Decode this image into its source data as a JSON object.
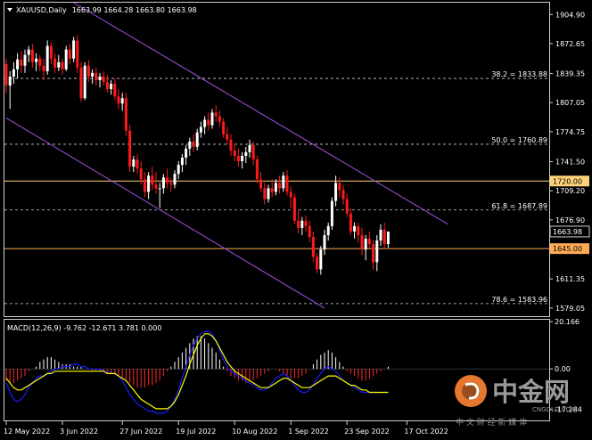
{
  "chart_data": [
    {
      "type": "candlestick",
      "title": "XAUUSD,Daily",
      "ohlc_readout": "1663.99 1664.28 1663.80 1663.98",
      "ylim": [
        1570,
        1918
      ],
      "y_ticks": [
        "1904.90",
        "1872.65",
        "1839.35",
        "1807.05",
        "1774.75",
        "1741.50",
        "1709.20",
        "1676.90",
        "1644.60",
        "1611.35",
        "1579.05"
      ],
      "x_ticks": [
        "12 May 2022",
        "3 Jun 2022",
        "27 Jun 2022",
        "19 Jul 2022",
        "10 Aug 2022",
        "1 Sep 2022",
        "23 Sep 2022",
        "17 Oct 2022"
      ],
      "x_tick_index": [
        0,
        15,
        31,
        46,
        61,
        76,
        91,
        107
      ],
      "last_price_label": "1663.98",
      "last_price": 1663.98,
      "horizontal_levels": [
        {
          "label": "1720.00",
          "value": 1720.0,
          "color": "#ffd27a"
        },
        {
          "label": "1645.00",
          "value": 1645.0,
          "color": "#ffaa55"
        }
      ],
      "fib_levels": [
        {
          "label": "38.2 = 1833.88",
          "value": 1833.88
        },
        {
          "label": "50.0 = 1760.89",
          "value": 1760.89
        },
        {
          "label": "61.8 = 1687.89",
          "value": 1687.89
        },
        {
          "label": "78.6 = 1583.96",
          "value": 1583.96
        }
      ],
      "channel": {
        "color": "#a24fe0",
        "upper": [
          {
            "i": 18,
            "v": 1918
          },
          {
            "i": 118,
            "v": 1672
          }
        ],
        "lower": [
          {
            "i": 0,
            "v": 1790
          },
          {
            "i": 85,
            "v": 1579
          }
        ]
      },
      "candles": [
        [
          1850,
          1856,
          1818,
          1826
        ],
        [
          1826,
          1842,
          1800,
          1836
        ],
        [
          1836,
          1852,
          1828,
          1844
        ],
        [
          1844,
          1862,
          1834,
          1855
        ],
        [
          1855,
          1864,
          1840,
          1848
        ],
        [
          1848,
          1866,
          1840,
          1860
        ],
        [
          1860,
          1870,
          1852,
          1866
        ],
        [
          1866,
          1872,
          1846,
          1852
        ],
        [
          1852,
          1862,
          1842,
          1856
        ],
        [
          1856,
          1860,
          1842,
          1848
        ],
        [
          1848,
          1856,
          1832,
          1842
        ],
        [
          1842,
          1876,
          1838,
          1870
        ],
        [
          1870,
          1874,
          1850,
          1856
        ],
        [
          1856,
          1862,
          1840,
          1846
        ],
        [
          1846,
          1860,
          1842,
          1852
        ],
        [
          1852,
          1856,
          1838,
          1844
        ],
        [
          1844,
          1870,
          1842,
          1866
        ],
        [
          1866,
          1872,
          1850,
          1856
        ],
        [
          1856,
          1880,
          1852,
          1876
        ],
        [
          1876,
          1882,
          1840,
          1846
        ],
        [
          1846,
          1852,
          1808,
          1812
        ],
        [
          1812,
          1852,
          1810,
          1848
        ],
        [
          1848,
          1854,
          1830,
          1836
        ],
        [
          1836,
          1844,
          1828,
          1840
        ],
        [
          1840,
          1846,
          1826,
          1832
        ],
        [
          1832,
          1840,
          1824,
          1836
        ],
        [
          1836,
          1842,
          1826,
          1830
        ],
        [
          1830,
          1838,
          1818,
          1822
        ],
        [
          1822,
          1832,
          1816,
          1828
        ],
        [
          1828,
          1834,
          1810,
          1814
        ],
        [
          1814,
          1822,
          1800,
          1806
        ],
        [
          1806,
          1818,
          1798,
          1812
        ],
        [
          1812,
          1818,
          1770,
          1776
        ],
        [
          1776,
          1782,
          1730,
          1736
        ],
        [
          1736,
          1748,
          1730,
          1744
        ],
        [
          1744,
          1750,
          1728,
          1734
        ],
        [
          1734,
          1742,
          1716,
          1722
        ],
        [
          1722,
          1730,
          1702,
          1708
        ],
        [
          1708,
          1730,
          1700,
          1726
        ],
        [
          1726,
          1736,
          1710,
          1716
        ],
        [
          1716,
          1730,
          1706,
          1712
        ],
        [
          1712,
          1718,
          1690,
          1712
        ],
        [
          1712,
          1728,
          1706,
          1724
        ],
        [
          1724,
          1734,
          1712,
          1718
        ],
        [
          1718,
          1724,
          1708,
          1716
        ],
        [
          1716,
          1732,
          1712,
          1728
        ],
        [
          1728,
          1742,
          1722,
          1738
        ],
        [
          1738,
          1750,
          1730,
          1746
        ],
        [
          1746,
          1760,
          1738,
          1756
        ],
        [
          1756,
          1768,
          1748,
          1764
        ],
        [
          1764,
          1772,
          1752,
          1758
        ],
        [
          1758,
          1778,
          1754,
          1774
        ],
        [
          1774,
          1786,
          1768,
          1780
        ],
        [
          1780,
          1792,
          1772,
          1788
        ],
        [
          1788,
          1796,
          1776,
          1782
        ],
        [
          1782,
          1800,
          1778,
          1796
        ],
        [
          1796,
          1804,
          1786,
          1792
        ],
        [
          1792,
          1798,
          1780,
          1786
        ],
        [
          1786,
          1790,
          1768,
          1772
        ],
        [
          1772,
          1780,
          1760,
          1766
        ],
        [
          1766,
          1772,
          1748,
          1754
        ],
        [
          1754,
          1762,
          1742,
          1748
        ],
        [
          1748,
          1756,
          1736,
          1742
        ],
        [
          1742,
          1752,
          1734,
          1748
        ],
        [
          1748,
          1758,
          1740,
          1752
        ],
        [
          1752,
          1766,
          1746,
          1760
        ],
        [
          1760,
          1764,
          1738,
          1744
        ],
        [
          1744,
          1748,
          1718,
          1722
        ],
        [
          1722,
          1730,
          1708,
          1712
        ],
        [
          1712,
          1718,
          1694,
          1700
        ],
        [
          1700,
          1716,
          1696,
          1712
        ],
        [
          1712,
          1722,
          1702,
          1708
        ],
        [
          1708,
          1722,
          1704,
          1718
        ],
        [
          1718,
          1726,
          1706,
          1712
        ],
        [
          1712,
          1730,
          1708,
          1726
        ],
        [
          1726,
          1732,
          1704,
          1708
        ],
        [
          1708,
          1714,
          1690,
          1702
        ],
        [
          1702,
          1706,
          1672,
          1676
        ],
        [
          1676,
          1688,
          1662,
          1668
        ],
        [
          1668,
          1680,
          1660,
          1676
        ],
        [
          1676,
          1682,
          1664,
          1670
        ],
        [
          1670,
          1676,
          1652,
          1658
        ],
        [
          1658,
          1664,
          1630,
          1636
        ],
        [
          1636,
          1640,
          1618,
          1622
        ],
        [
          1622,
          1648,
          1616,
          1644
        ],
        [
          1644,
          1666,
          1638,
          1660
        ],
        [
          1660,
          1674,
          1654,
          1670
        ],
        [
          1670,
          1702,
          1666,
          1698
        ],
        [
          1698,
          1726,
          1692,
          1718
        ],
        [
          1718,
          1724,
          1702,
          1710
        ],
        [
          1710,
          1716,
          1694,
          1700
        ],
        [
          1700,
          1706,
          1680,
          1684
        ],
        [
          1684,
          1690,
          1660,
          1664
        ],
        [
          1664,
          1674,
          1656,
          1670
        ],
        [
          1670,
          1674,
          1652,
          1660
        ],
        [
          1660,
          1668,
          1638,
          1644
        ],
        [
          1644,
          1660,
          1632,
          1656
        ],
        [
          1656,
          1664,
          1646,
          1650
        ],
        [
          1650,
          1654,
          1622,
          1630
        ],
        [
          1630,
          1660,
          1620,
          1654
        ],
        [
          1654,
          1672,
          1648,
          1666
        ],
        [
          1666,
          1674,
          1644,
          1650
        ],
        [
          1650,
          1664,
          1646,
          1664
        ]
      ]
    },
    {
      "type": "macd",
      "title": "MACD(12,26,9) -9.762 -12.671 3.781 0.000",
      "ylim": [
        -22,
        21
      ],
      "y_ticks": [
        "20.166",
        "0.00",
        "-17.284"
      ],
      "series": [
        {
          "name": "main",
          "color": "#1a1aff",
          "values": [
            -6,
            -10,
            -13,
            -14,
            -13,
            -11,
            -8,
            -6,
            -4,
            -3,
            -3,
            -2,
            -1,
            0,
            0,
            1,
            1,
            1,
            2,
            2,
            1,
            1,
            0,
            0,
            0,
            0,
            -1,
            -1,
            -2,
            -2,
            -3,
            -5,
            -8,
            -11,
            -13,
            -15,
            -16,
            -17,
            -18,
            -18,
            -19,
            -19,
            -19,
            -18,
            -16,
            -13,
            -9,
            -4,
            1,
            6,
            10,
            13,
            15,
            16,
            16,
            15,
            12,
            8,
            4,
            1,
            -1,
            -2,
            -3,
            -4,
            -5,
            -6,
            -7,
            -8,
            -9,
            -9,
            -8,
            -6,
            -4,
            -3,
            -2,
            -3,
            -5,
            -7,
            -9,
            -10,
            -10,
            -9,
            -7,
            -4,
            -2,
            0,
            1,
            0,
            -1,
            -3,
            -5,
            -6,
            -7,
            -8,
            -9,
            -10,
            -10,
            -10,
            -10,
            -10,
            -10,
            -10,
            -10
          ]
        },
        {
          "name": "signal",
          "color": "#ffff00",
          "values": [
            -4,
            -6,
            -8,
            -9,
            -9,
            -8,
            -7,
            -6,
            -5,
            -4,
            -3,
            -2,
            -2,
            -1,
            -1,
            -1,
            -1,
            -1,
            -1,
            -1,
            -1,
            -1,
            -1,
            -1,
            -1,
            -1,
            -1,
            -2,
            -2,
            -2,
            -3,
            -4,
            -5,
            -7,
            -9,
            -11,
            -13,
            -14,
            -15,
            -16,
            -17,
            -17,
            -17,
            -17,
            -16,
            -14,
            -11,
            -7,
            -3,
            2,
            6,
            10,
            13,
            15,
            15,
            14,
            12,
            9,
            6,
            3,
            1,
            -1,
            -2,
            -3,
            -4,
            -5,
            -6,
            -7,
            -8,
            -8,
            -8,
            -7,
            -6,
            -5,
            -4,
            -4,
            -5,
            -6,
            -7,
            -8,
            -8,
            -8,
            -7,
            -6,
            -5,
            -4,
            -3,
            -3,
            -3,
            -4,
            -5,
            -6,
            -7,
            -7,
            -8,
            -9,
            -9,
            -10,
            -10,
            -10,
            -10,
            -10,
            -10
          ]
        }
      ],
      "histogram": [
        -5,
        -6,
        -6,
        -5,
        -4,
        -3,
        -1,
        0,
        1,
        3,
        4,
        5,
        5,
        4,
        3,
        2,
        2,
        2,
        1,
        1,
        1,
        0,
        0,
        -1,
        -1,
        -1,
        -1,
        -2,
        -2,
        -2,
        -3,
        -4,
        -5,
        -6,
        -7,
        -8,
        -8,
        -8,
        -7,
        -7,
        -6,
        -5,
        -3,
        -1,
        1,
        3,
        5,
        7,
        9,
        11,
        13,
        14,
        14,
        13,
        11,
        9,
        7,
        4,
        1,
        -1,
        -3,
        -4,
        -5,
        -5,
        -6,
        -6,
        -5,
        -4,
        -3,
        -2,
        -1,
        0,
        0,
        -1,
        -2,
        -3,
        -4,
        -4,
        -4,
        -3,
        -2,
        0,
        2,
        4,
        6,
        7,
        8,
        7,
        5,
        3,
        1,
        -1,
        -2,
        -3,
        -4,
        -5,
        -5,
        -4,
        -3,
        -2,
        -1,
        0,
        1
      ]
    }
  ],
  "watermark": {
    "brand_cn": "中金网",
    "domain": "CNGOLD.COM",
    "tagline": "中 文 财 经 新 媒 体"
  }
}
